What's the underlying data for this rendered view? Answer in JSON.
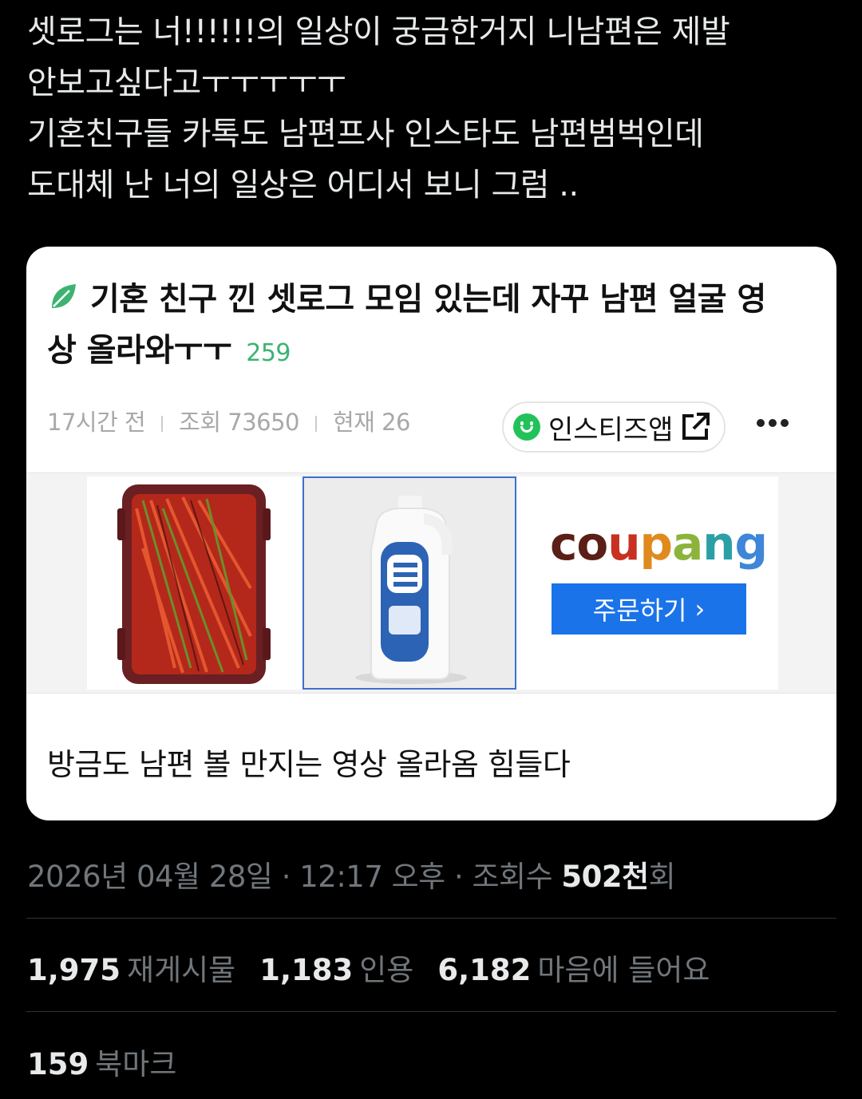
{
  "tweet": {
    "lines": [
      "셋로그는 너!!!!!!의 일상이 궁금한거지 니남편은 제발",
      "안보고싶다고ㅜㅜㅜㅜㅜ",
      "기혼친구들 카톡도 남편프사 인스타도 남편범벅인데",
      "도대체 난 너의 일상은 어디서 보니 그럼 .."
    ]
  },
  "card": {
    "title_line1": "기혼 친구 낀 셋로그 모임 있는데 자꾸 남편 얼굴 영",
    "title_line2": "상 올라와ㅜㅜ",
    "comment_count": "259",
    "meta": {
      "time": "17시간 전",
      "views": "조회 73650",
      "current": "현재 26"
    },
    "app_label": "인스티즈앱",
    "ad": {
      "brand": "coupang",
      "button_label": "주문하기",
      "button_chevron": "›"
    },
    "body": "방금도 남편 볼 만지는 영상 올라옴 힘들다"
  },
  "timestamp": {
    "prefix": "2026년 04월 28일 · 12:17 오후 · 조회수 ",
    "views_num": "502천",
    "views_suffix": "회"
  },
  "stats": [
    {
      "num": "1,975",
      "label": "재게시물"
    },
    {
      "num": "1,183",
      "label": "인용"
    },
    {
      "num": "6,182",
      "label": "마음에 들어요"
    }
  ],
  "bookmarks": {
    "num": "159",
    "label": "북마크"
  },
  "colors": {
    "background": "#000000",
    "text": "#e7e9ea",
    "muted": "#71767b",
    "card": "#ffffff",
    "accent_green": "#3cb371",
    "coupang_blue": "#1a73e8"
  },
  "icons": [
    "leaf-icon",
    "smile-icon",
    "external-link-icon",
    "more-icon"
  ]
}
